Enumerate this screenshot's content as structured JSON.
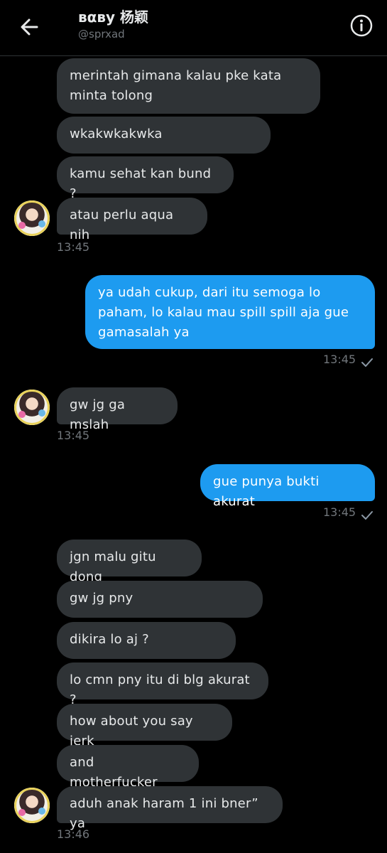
{
  "header": {
    "back_icon": "arrow-left-icon",
    "title": "вαву 杨颖",
    "handle": "@sprxad",
    "info_icon": "info-circle-icon"
  },
  "messages": [
    {
      "side": "in",
      "text": "merintah gimana kalau pke kata minta tolong"
    },
    {
      "side": "in",
      "text": "wkakwkakwka"
    },
    {
      "side": "in",
      "text": "kamu sehat kan bund ?"
    },
    {
      "side": "in",
      "text": "atau perlu aqua nih"
    },
    {
      "side": "in",
      "time": "13:45"
    },
    {
      "side": "out",
      "text": "ya udah cukup, dari itu semoga lo paham, lo kalau mau spill spill aja gue gamasalah ya"
    },
    {
      "side": "out",
      "time": "13:45"
    },
    {
      "side": "in",
      "text": "gw jg ga mslah"
    },
    {
      "side": "in",
      "time": "13:45"
    },
    {
      "side": "out",
      "text": "gue punya bukti akurat"
    },
    {
      "side": "out",
      "time": "13:45"
    },
    {
      "side": "in",
      "text": "jgn malu gitu dong"
    },
    {
      "side": "in",
      "text": "gw jg pny"
    },
    {
      "side": "in",
      "text": "dikira lo aj ?"
    },
    {
      "side": "in",
      "text": "lo cmn pny itu di blg akurat ?"
    },
    {
      "side": "in",
      "text": "how about you say jerk"
    },
    {
      "side": "in",
      "text": "and motherfucker"
    },
    {
      "side": "in",
      "text": "aduh anak haram 1 ini bner” ya"
    },
    {
      "side": "in",
      "time": "13:46"
    }
  ],
  "colors": {
    "background": "#000000",
    "incoming_bubble": "#2f3336",
    "outgoing_bubble": "#1d9bf0",
    "muted_text": "#71767b"
  }
}
